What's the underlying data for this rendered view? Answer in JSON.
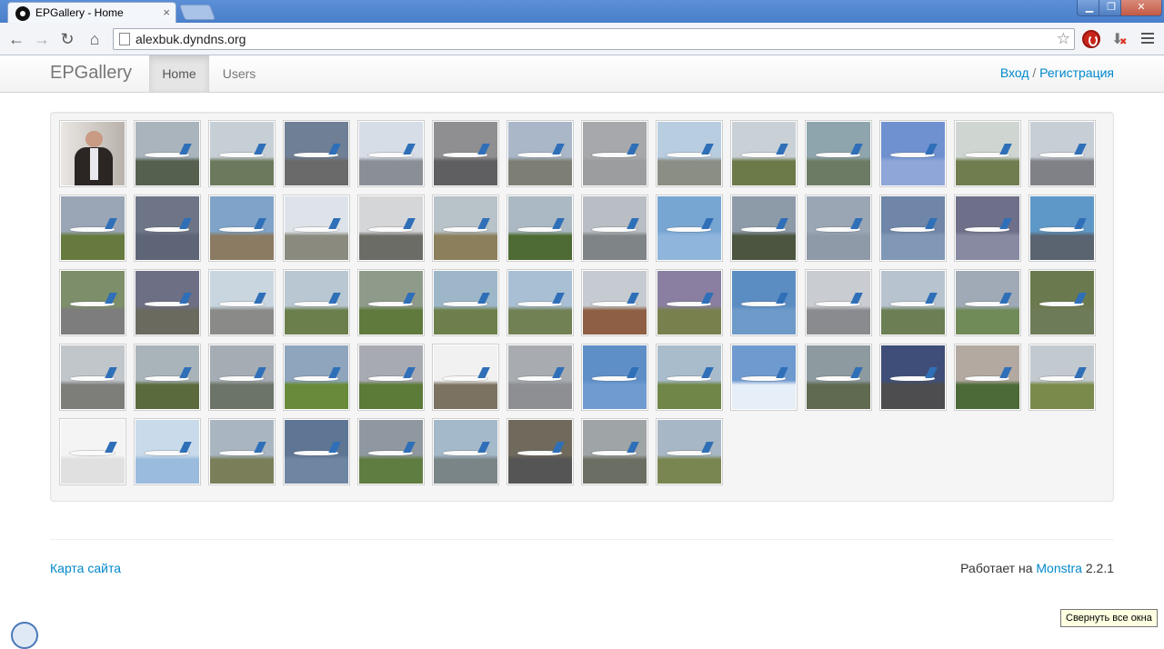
{
  "browser": {
    "tab_title": "EPGallery - Home",
    "tab_close": "×",
    "url": "alexbuk.dyndns.org",
    "window_min": "▁",
    "window_max": "❐",
    "window_close": "✕",
    "back_icon": "arrow-left",
    "forward_icon": "arrow-right",
    "reload_icon": "reload",
    "home_icon": "home",
    "star_icon": "star"
  },
  "navbar": {
    "brand": "EPGallery",
    "items": [
      {
        "label": "Home",
        "active": true
      },
      {
        "label": "Users",
        "active": false
      }
    ],
    "login": "Вход",
    "separator": "/",
    "register": "Регистрация"
  },
  "gallery": {
    "thumbnails": [
      {
        "scene": "portrait",
        "sky": "#d9d4cf",
        "ground": "#8a7f78"
      },
      {
        "scene": "plane",
        "sky": "#aab4bd",
        "ground": "#55604f"
      },
      {
        "scene": "plane",
        "sky": "#c7cfd6",
        "ground": "#6b7a5c"
      },
      {
        "scene": "plane",
        "sky": "#6f7f95",
        "ground": "#6a6a6a"
      },
      {
        "scene": "plane",
        "sky": "#d6dde6",
        "ground": "#8a8f96"
      },
      {
        "scene": "plane",
        "sky": "#8f8f92",
        "ground": "#5f5f62"
      },
      {
        "scene": "plane",
        "sky": "#a9b7c8",
        "ground": "#7d7f74"
      },
      {
        "scene": "plane",
        "sky": "#a6a8ab",
        "ground": "#9b9d9f"
      },
      {
        "scene": "plane",
        "sky": "#b9cde0",
        "ground": "#8a8e84"
      },
      {
        "scene": "plane",
        "sky": "#c9d0d6",
        "ground": "#6c7a4a"
      },
      {
        "scene": "plane",
        "sky": "#8fa5ad",
        "ground": "#6c7c64"
      },
      {
        "scene": "plane",
        "sky": "#6f91d0",
        "ground": "#8ea7d8"
      },
      {
        "scene": "plane",
        "sky": "#cfd6d2",
        "ground": "#6f7d4f"
      },
      {
        "scene": "plane",
        "sky": "#c7ced6",
        "ground": "#7f8186"
      },
      {
        "scene": "plane",
        "sky": "#9aa6b6",
        "ground": "#667a3f"
      },
      {
        "scene": "plane",
        "sky": "#6d7586",
        "ground": "#5e6577"
      },
      {
        "scene": "plane",
        "sky": "#7fa3c9",
        "ground": "#8b7b62"
      },
      {
        "scene": "plane",
        "sky": "#dde3e9",
        "ground": "#8a8a7e"
      },
      {
        "scene": "plane",
        "sky": "#d4d6d8",
        "ground": "#6c6c66"
      },
      {
        "scene": "plane",
        "sky": "#b7c2c9",
        "ground": "#8c7f5c"
      },
      {
        "scene": "plane",
        "sky": "#aab9c3",
        "ground": "#4d6b33"
      },
      {
        "scene": "plane",
        "sky": "#b9bec4",
        "ground": "#7f8487"
      },
      {
        "scene": "plane",
        "sky": "#78a6d2",
        "ground": "#8fb5dc"
      },
      {
        "scene": "plane",
        "sky": "#8d9aa8",
        "ground": "#4c5540"
      },
      {
        "scene": "plane",
        "sky": "#9aa6b4",
        "ground": "#8f9aa8"
      },
      {
        "scene": "plane",
        "sky": "#6f86a8",
        "ground": "#8097b6"
      },
      {
        "scene": "plane",
        "sky": "#6e6f88",
        "ground": "#878aa0"
      },
      {
        "scene": "plane",
        "sky": "#5e98c8",
        "ground": "#5a6470"
      },
      {
        "scene": "plane",
        "sky": "#7d8f6a",
        "ground": "#7d7d7d"
      },
      {
        "scene": "plane",
        "sky": "#6d6f85",
        "ground": "#6a6a5f"
      },
      {
        "scene": "plane",
        "sky": "#c9d6df",
        "ground": "#8a8b88"
      },
      {
        "scene": "plane",
        "sky": "#b9c7d2",
        "ground": "#6b7f4c"
      },
      {
        "scene": "plane",
        "sky": "#8f9b8a",
        "ground": "#5f7a3c"
      },
      {
        "scene": "plane",
        "sky": "#9db7c8",
        "ground": "#6d7f4a"
      },
      {
        "scene": "plane",
        "sky": "#a9bfd4",
        "ground": "#728154"
      },
      {
        "scene": "plane",
        "sky": "#c5cbd0",
        "ground": "#8e5f44"
      },
      {
        "scene": "plane",
        "sky": "#8a7fa0",
        "ground": "#78804e"
      },
      {
        "scene": "plane",
        "sky": "#5b8dc2",
        "ground": "#6d9ac9"
      },
      {
        "scene": "plane",
        "sky": "#c9cdd2",
        "ground": "#8a8b8e"
      },
      {
        "scene": "plane",
        "sky": "#b7c4cf",
        "ground": "#6b7e54"
      },
      {
        "scene": "plane",
        "sky": "#a0aab6",
        "ground": "#708a58"
      },
      {
        "scene": "plane",
        "sky": "#6b7a4e",
        "ground": "#6e7b58"
      },
      {
        "scene": "plane",
        "sky": "#c1c6cb",
        "ground": "#7d7d7a"
      },
      {
        "scene": "plane",
        "sky": "#a9b4ba",
        "ground": "#5b6a3c"
      },
      {
        "scene": "plane",
        "sky": "#a5acb4",
        "ground": "#6b7466"
      },
      {
        "scene": "plane",
        "sky": "#8ea5bd",
        "ground": "#688a3a"
      },
      {
        "scene": "plane",
        "sky": "#a8aab2",
        "ground": "#5c7a38"
      },
      {
        "scene": "plane",
        "sky": "#f1f1f1",
        "ground": "#7b7262"
      },
      {
        "scene": "plane",
        "sky": "#a8acb0",
        "ground": "#8d8f92"
      },
      {
        "scene": "plane",
        "sky": "#5f8fc7",
        "ground": "#6f9bd0"
      },
      {
        "scene": "plane",
        "sky": "#a9bccb",
        "ground": "#6f8648"
      },
      {
        "scene": "plane",
        "sky": "#6f9ad0",
        "ground": "#e6eef7"
      },
      {
        "scene": "plane",
        "sky": "#8d9aa0",
        "ground": "#5f6a50"
      },
      {
        "scene": "plane",
        "sky": "#3f4e78",
        "ground": "#4d4d4f"
      },
      {
        "scene": "plane",
        "sky": "#b3a9a0",
        "ground": "#4c6a38"
      },
      {
        "scene": "plane",
        "sky": "#c2c9cf",
        "ground": "#7a8a4a"
      },
      {
        "scene": "plane",
        "sky": "#f4f4f4",
        "ground": "#e0e0e0"
      },
      {
        "scene": "plane",
        "sky": "#c9dbeb",
        "ground": "#9bbbdc"
      },
      {
        "scene": "plane",
        "sky": "#a9b6c2",
        "ground": "#7a7f5a"
      },
      {
        "scene": "plane",
        "sky": "#5f7594",
        "ground": "#6f86a2"
      },
      {
        "scene": "plane",
        "sky": "#8f98a0",
        "ground": "#5f7d40"
      },
      {
        "scene": "plane",
        "sky": "#a4b9c9",
        "ground": "#7a8588"
      },
      {
        "scene": "plane",
        "sky": "#6f6a5c",
        "ground": "#555"
      },
      {
        "scene": "plane",
        "sky": "#9fa4a6",
        "ground": "#6b6f63"
      },
      {
        "scene": "plane",
        "sky": "#a8b7c5",
        "ground": "#7a8651"
      }
    ]
  },
  "footer": {
    "sitemap": "Карта сайта",
    "powered_prefix": "Работает на",
    "powered_link": "Monstra",
    "powered_version": "2.2.1"
  },
  "taskbar_tooltip": "Свернуть все окна"
}
